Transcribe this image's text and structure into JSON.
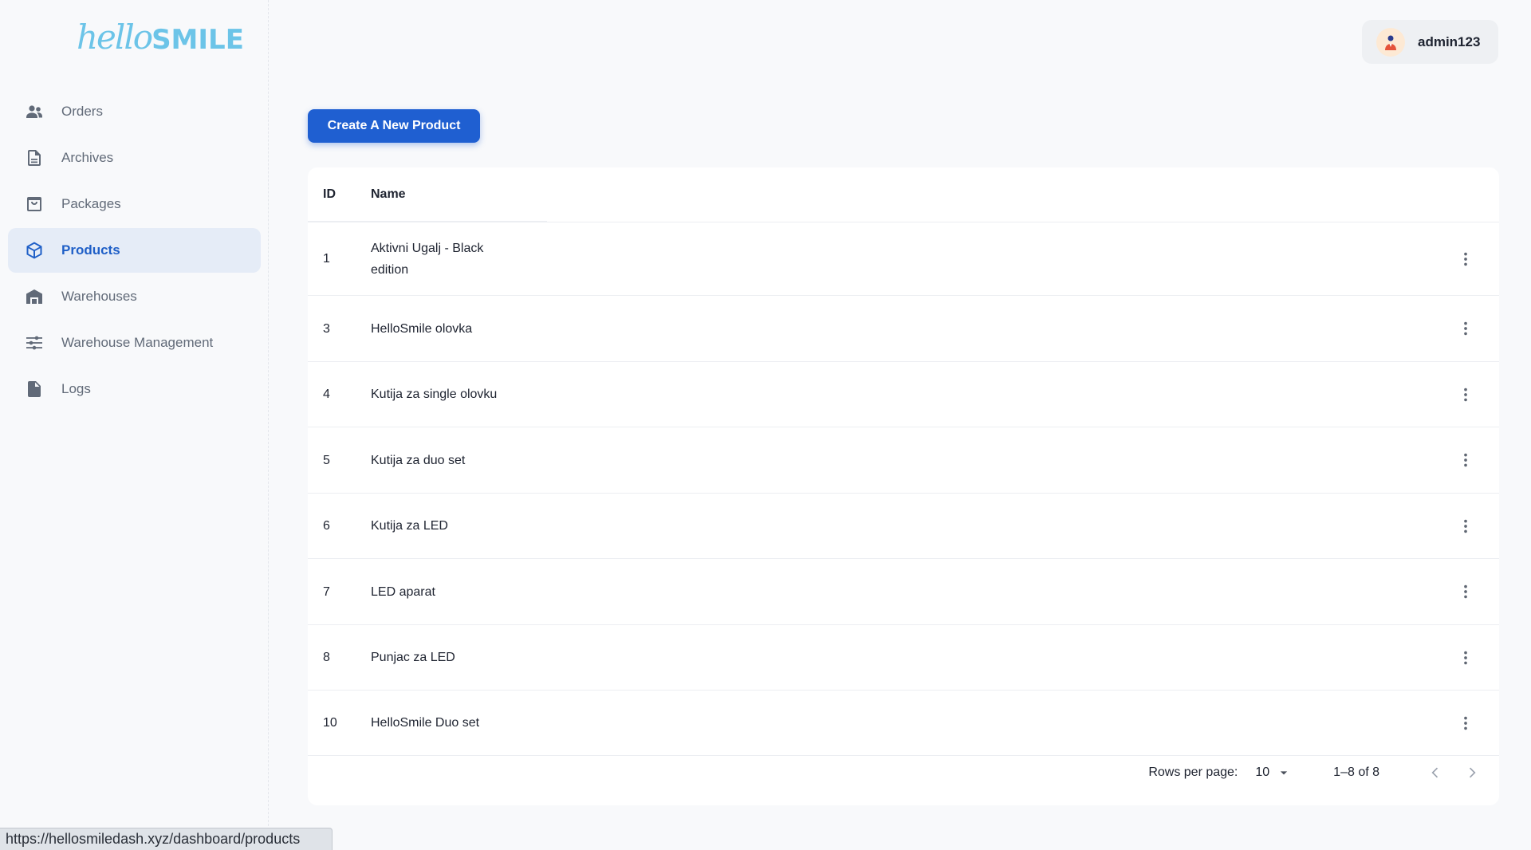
{
  "brand": {
    "script": "hello",
    "caps": "SMILE",
    "color": "#6cc4e8"
  },
  "sidebar": {
    "items": [
      {
        "label": "Orders",
        "icon": "users-icon"
      },
      {
        "label": "Archives",
        "icon": "document-icon"
      },
      {
        "label": "Packages",
        "icon": "bag-icon"
      },
      {
        "label": "Products",
        "icon": "cube-icon",
        "active": true
      },
      {
        "label": "Warehouses",
        "icon": "warehouse-icon"
      },
      {
        "label": "Warehouse Management",
        "icon": "sliders-icon"
      },
      {
        "label": "Logs",
        "icon": "file-text-icon"
      }
    ]
  },
  "header": {
    "username": "admin123"
  },
  "actions": {
    "create_label": "Create A New Product",
    "accent": "#1f5fd1"
  },
  "table": {
    "columns": {
      "id": "ID",
      "name": "Name"
    },
    "rows": [
      {
        "id": "1",
        "name": "Aktivni Ugalj - Black edition"
      },
      {
        "id": "3",
        "name": "HelloSmile olovka"
      },
      {
        "id": "4",
        "name": "Kutija za single olovku"
      },
      {
        "id": "5",
        "name": "Kutija za duo set"
      },
      {
        "id": "6",
        "name": "Kutija za LED"
      },
      {
        "id": "7",
        "name": "LED aparat"
      },
      {
        "id": "8",
        "name": "Punjac za LED"
      },
      {
        "id": "10",
        "name": "HelloSmile Duo set"
      }
    ]
  },
  "pagination": {
    "rows_per_page_label": "Rows per page:",
    "rows_per_page_value": "10",
    "range": "1–8 of 8"
  },
  "status_bar": {
    "url": "https://hellosmiledash.xyz/dashboard/products"
  }
}
